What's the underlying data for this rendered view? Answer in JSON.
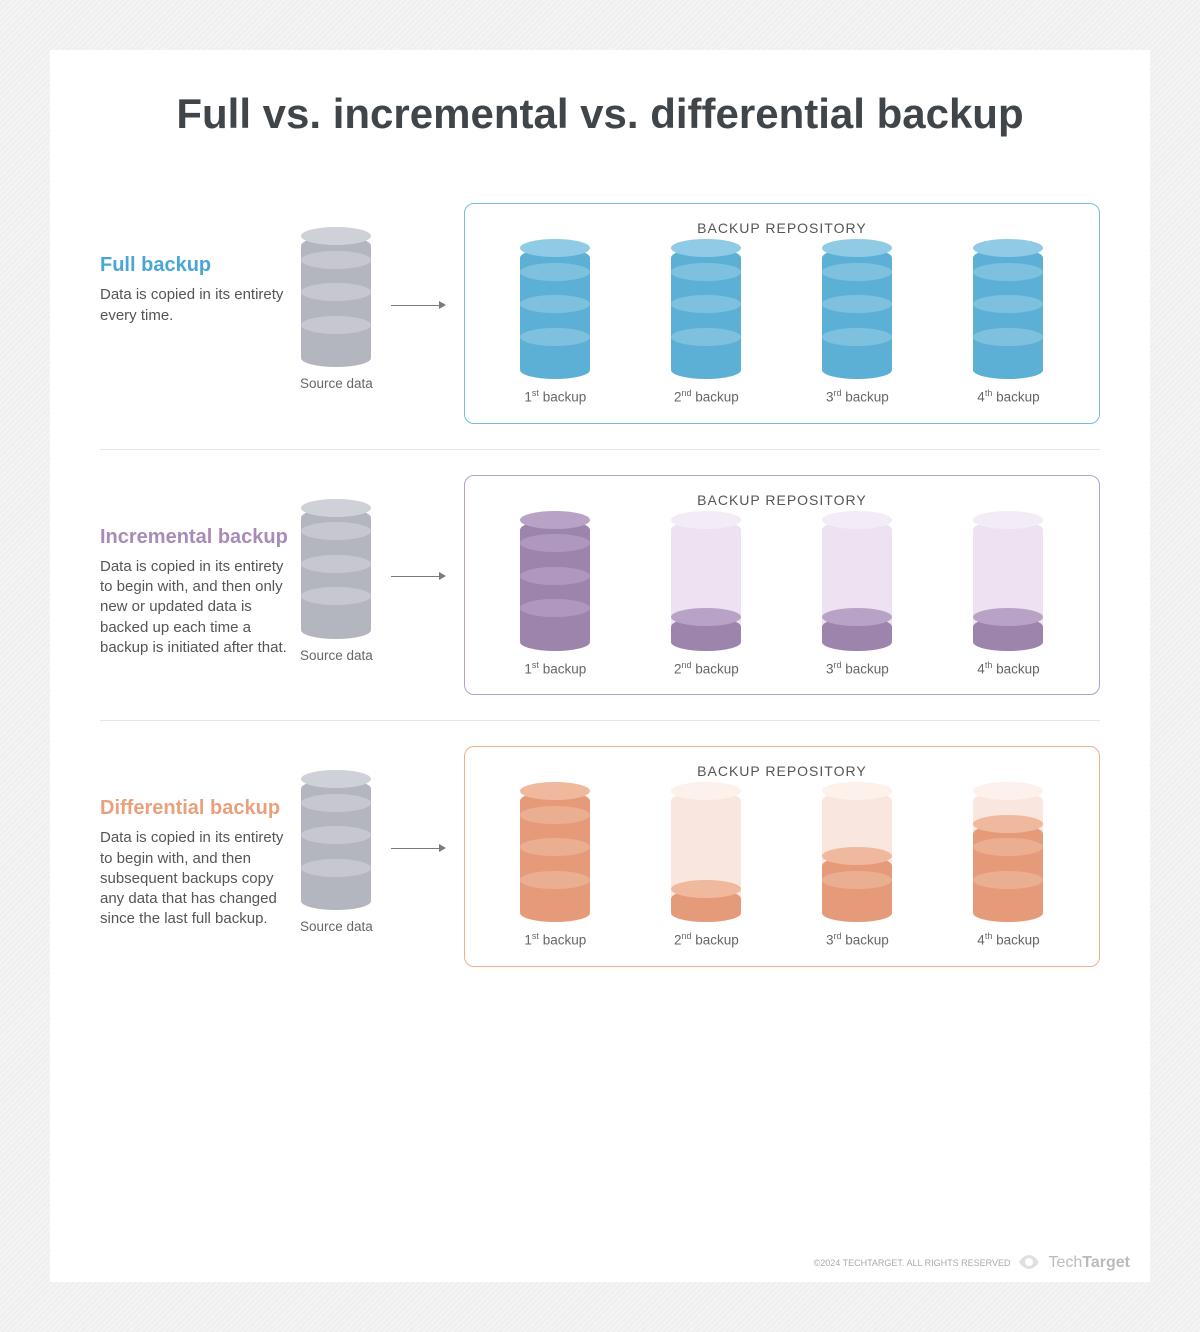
{
  "title": "Full vs. incremental vs. differential backup",
  "repo_label": "BACKUP REPOSITORY",
  "source_label": "Source data",
  "sections": [
    {
      "key": "full",
      "heading": "Full backup",
      "description": "Data is copied in its entirety every time.",
      "backups": [
        {
          "ordinal": "1",
          "suffix": "st",
          "word": "backup",
          "fill": 4
        },
        {
          "ordinal": "2",
          "suffix": "nd",
          "word": "backup",
          "fill": 4
        },
        {
          "ordinal": "3",
          "suffix": "rd",
          "word": "backup",
          "fill": 4
        },
        {
          "ordinal": "4",
          "suffix": "th",
          "word": "backup",
          "fill": 4
        }
      ],
      "color": "blue"
    },
    {
      "key": "incremental",
      "heading": "Incremental backup",
      "description": "Data is copied in its entirety to begin with, and then only new or updated data is backed up each time a backup is initiated after that.",
      "backups": [
        {
          "ordinal": "1",
          "suffix": "st",
          "word": "backup",
          "fill": 4
        },
        {
          "ordinal": "2",
          "suffix": "nd",
          "word": "backup",
          "fill": 1
        },
        {
          "ordinal": "3",
          "suffix": "rd",
          "word": "backup",
          "fill": 1
        },
        {
          "ordinal": "4",
          "suffix": "th",
          "word": "backup",
          "fill": 1
        }
      ],
      "color": "purple"
    },
    {
      "key": "differential",
      "heading": "Differential backup",
      "description": "Data is copied in its entirety to begin with, and then subsequent backups copy any data that has changed since the last full backup.",
      "backups": [
        {
          "ordinal": "1",
          "suffix": "st",
          "word": "backup",
          "fill": 4
        },
        {
          "ordinal": "2",
          "suffix": "nd",
          "word": "backup",
          "fill": 1
        },
        {
          "ordinal": "3",
          "suffix": "rd",
          "word": "backup",
          "fill": 2
        },
        {
          "ordinal": "4",
          "suffix": "th",
          "word": "backup",
          "fill": 3
        }
      ],
      "color": "orange"
    }
  ],
  "footer": {
    "copyright": "©2024 TECHTARGET. ALL RIGHTS RESERVED",
    "brand_light": "Tech",
    "brand_bold": "Target"
  }
}
